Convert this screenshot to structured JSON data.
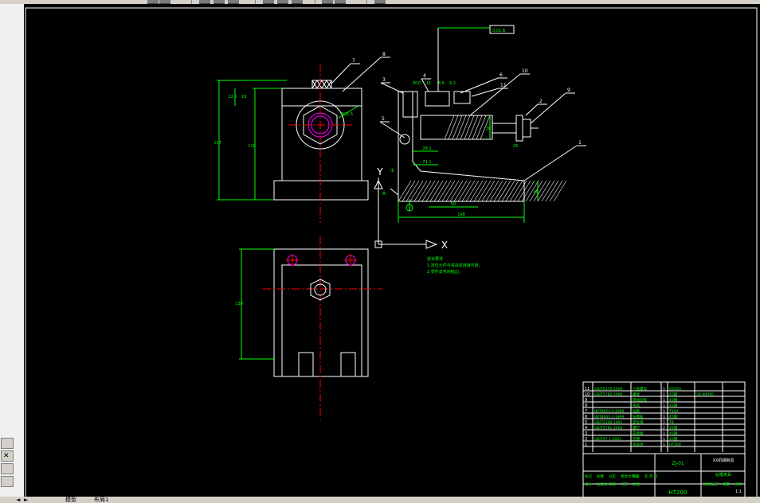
{
  "toolbar": {
    "icon_names": [
      "layer-icon",
      "layer-state-icon",
      "properties-icon",
      "pan-icon",
      "zoom-icon",
      "match-icon",
      "undo-icon",
      "redo-icon",
      "plot-icon",
      "preview-icon",
      "print-icon"
    ]
  },
  "layout_tabs": {
    "nav_prev": "◄",
    "nav_next": "►",
    "model": "模型",
    "layout": "布局1"
  },
  "sidebar": {
    "close_label": "✕"
  },
  "drawing": {
    "part_labels": [
      "1",
      "2",
      "3",
      "4",
      "5",
      "6",
      "7",
      "8",
      "9",
      "10",
      "11"
    ],
    "tolerance_frame": "0.01 B",
    "dims": {
      "front_height_total": "117",
      "front_height": "116",
      "front_top_a": "22.5",
      "front_top_b": "19",
      "hole": "Φ31.5",
      "side_width": "148",
      "side_base": "50",
      "side_h": "60",
      "side_a": "28.1",
      "side_b": "71.1",
      "side_c": "38",
      "side_top_a": "Φ10",
      "side_top_b": "11",
      "side_top_c": "8.6",
      "side_top_d": "9.2",
      "side_right": "26",
      "plan_height": "138"
    },
    "datum_labels": [
      "A",
      "①"
    ],
    "ucs": {
      "y": "Y",
      "x": "X"
    },
    "tech_req": {
      "title": "技术要求",
      "line1": "1.定位元件与夹具体连接可靠。",
      "line2": "2.零件去毛刺锐边。"
    },
    "title_block": {
      "bom_rows": [
        {
          "no": "11",
          "code": "GB/T6170-2000",
          "name": "六角螺母",
          "qty": "1",
          "material": "Q235A",
          "note": ""
        },
        {
          "no": "10",
          "code": "GB/T5782-2000",
          "name": "螺栓",
          "qty": "1",
          "material": "45钢",
          "note": "28-40HRC"
        },
        {
          "no": "9",
          "code": "",
          "name": "转动压板",
          "qty": "1",
          "material": "45钢",
          "note": ""
        },
        {
          "no": "8",
          "code": "",
          "name": "夹具",
          "qty": "1",
          "material": "45钢",
          "note": ""
        },
        {
          "no": "7",
          "code": "JB/T8024.3-1999",
          "name": "钻套",
          "qty": "1",
          "material": "T10A",
          "note": ""
        },
        {
          "no": "6",
          "code": "JB/T8045.3-1999",
          "name": "钻模板",
          "qty": "1",
          "material": "45钢",
          "note": ""
        },
        {
          "no": "5",
          "code": "GB/T2148-1991",
          "name": "定位销",
          "qty": "1",
          "material": "T8",
          "note": ""
        },
        {
          "no": "4",
          "code": "GB/T5781-2000",
          "name": "螺钉",
          "qty": "2",
          "material": "45钢",
          "note": ""
        },
        {
          "no": "3",
          "code": "",
          "name": "支承板",
          "qty": "1",
          "material": "45钢",
          "note": ""
        },
        {
          "no": "2",
          "code": "GB/T97.1-2002",
          "name": "垫圈",
          "qty": "1",
          "material": "45钢",
          "note": ""
        },
        {
          "no": "1",
          "code": "",
          "name": "夹具体",
          "qty": "1",
          "material": "HT200",
          "note": ""
        }
      ],
      "footer_labels": [
        "标记",
        "处数",
        "分区",
        "更改文件号",
        "签名",
        "年.月.日",
        "设计",
        "标准化",
        "审核",
        "工艺",
        "批准"
      ],
      "drawing_no": "ZJ-01",
      "material": "HT200",
      "scale_label": "比例",
      "scale": "1:1",
      "mass_label": "重量",
      "stage_label": "阶段标记",
      "title": "钻模夹具",
      "org": "XX机械制造"
    }
  },
  "colors": {
    "canvas_bg": "#000000",
    "outline": "#ffffff",
    "dim": "#00ff00",
    "center": "#ff0000",
    "thread": "#ff00ff",
    "frame": "#ffffff",
    "label": "#ffffff",
    "tech": "#00ff00",
    "hatch": "#ffffff"
  }
}
